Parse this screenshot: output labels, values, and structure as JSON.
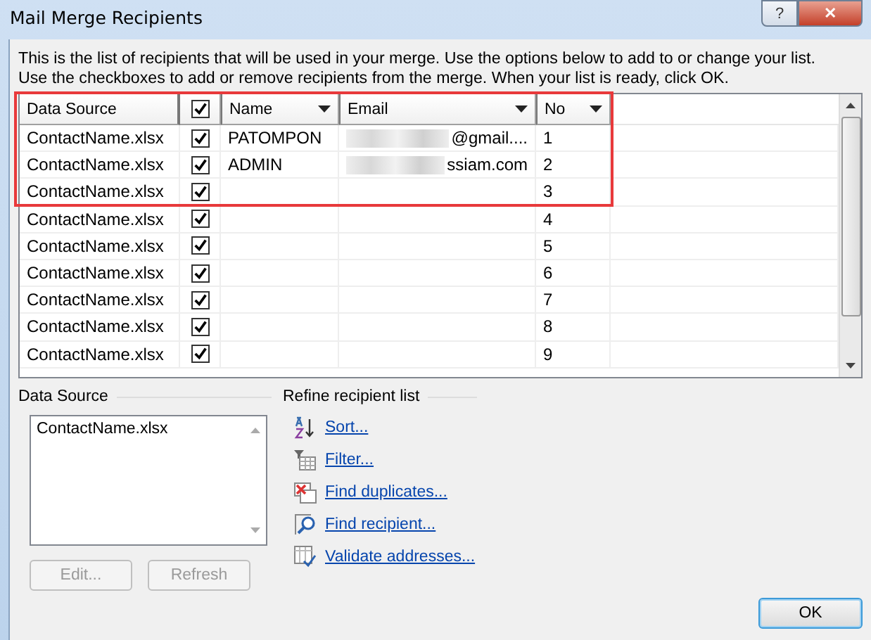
{
  "window": {
    "title": "Mail Merge Recipients",
    "help_button": "?",
    "close_button": "✕"
  },
  "intro": [
    "This is the list of recipients that will be used in your merge.  Use the options below to add to or change your list.",
    "Use the checkboxes to add or remove recipients from the merge.  When your list is ready, click OK."
  ],
  "table": {
    "columns": [
      {
        "kind": "text",
        "label": "Data Source",
        "dropdown": false
      },
      {
        "kind": "check",
        "checked": true
      },
      {
        "kind": "text",
        "label": "Name",
        "dropdown": true
      },
      {
        "kind": "text",
        "label": "Email",
        "dropdown": true
      },
      {
        "kind": "text",
        "label": "No",
        "dropdown": true
      }
    ],
    "rows": [
      {
        "source": "ContactName.xlsx",
        "checked": true,
        "name": "PATOMPON",
        "email": "@gmail....",
        "email_redacted": true,
        "no": "1"
      },
      {
        "source": "ContactName.xlsx",
        "checked": true,
        "name": "ADMIN",
        "email": "ssiam.com",
        "email_redacted": true,
        "no": "2"
      },
      {
        "source": "ContactName.xlsx",
        "checked": true,
        "no": "3"
      },
      {
        "source": "ContactName.xlsx",
        "checked": true,
        "no": "4"
      },
      {
        "source": "ContactName.xlsx",
        "checked": true,
        "no": "5"
      },
      {
        "source": "ContactName.xlsx",
        "checked": true,
        "no": "6"
      },
      {
        "source": "ContactName.xlsx",
        "checked": true,
        "no": "7"
      },
      {
        "source": "ContactName.xlsx",
        "checked": true,
        "no": "8"
      },
      {
        "source": "ContactName.xlsx",
        "checked": true,
        "no": "9"
      }
    ],
    "highlight": true
  },
  "data_source": {
    "label": "Data Source",
    "items": [
      "ContactName.xlsx"
    ],
    "buttons": [
      {
        "label": "Edit...",
        "disabled": true
      },
      {
        "label": "Refresh",
        "disabled": true
      }
    ]
  },
  "refine": {
    "label": "Refine recipient list",
    "links": [
      {
        "kind": "sort",
        "label": "Sort..."
      },
      {
        "kind": "filter",
        "label": "Filter..."
      },
      {
        "kind": "duplicates",
        "label": "Find duplicates..."
      },
      {
        "kind": "find",
        "label": "Find recipient..."
      },
      {
        "kind": "validate",
        "label": "Validate addresses..."
      }
    ]
  },
  "ok_button": "OK"
}
